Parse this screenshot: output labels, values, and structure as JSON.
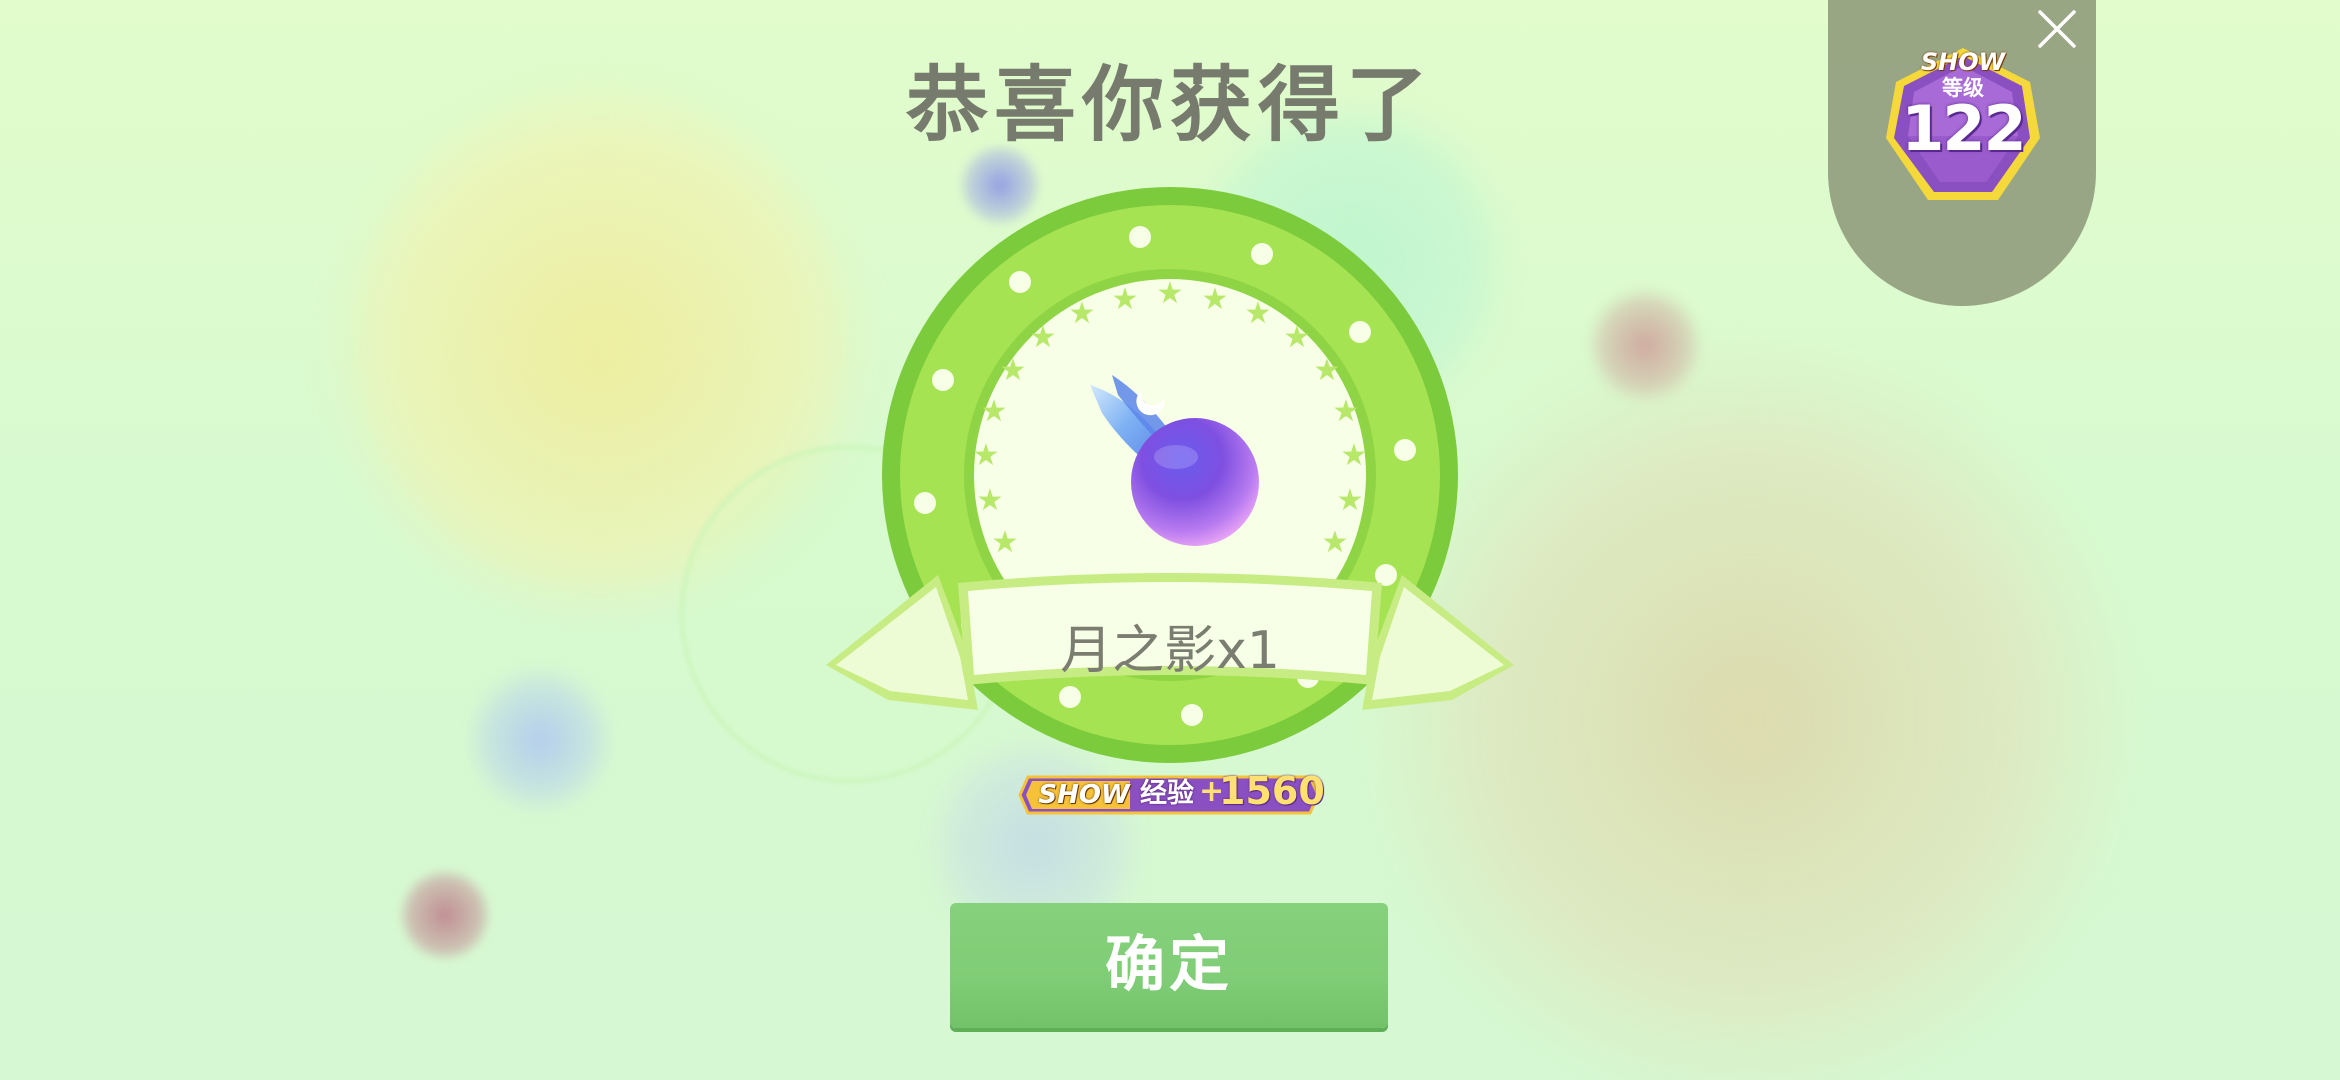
{
  "title": "恭喜你获得了",
  "reward": {
    "item_name": "月之影x1",
    "item_icon": "moon-shadow-orb-icon"
  },
  "exp_badge": {
    "show_text": "SHOW",
    "label": "经验",
    "plus": "+",
    "value": "1560"
  },
  "level_badge": {
    "show_text": "SHOW",
    "label": "等级",
    "level": "122"
  },
  "buttons": {
    "confirm": "确定",
    "close_icon": "close-icon"
  },
  "colors": {
    "background": "#dcfbd0",
    "medal_green": "#7ccb3c",
    "confirm_button": "#7fcd76",
    "level_panel": "#8c9678",
    "badge_purple": "#8a4fc0",
    "badge_gold": "#f5c23a"
  }
}
